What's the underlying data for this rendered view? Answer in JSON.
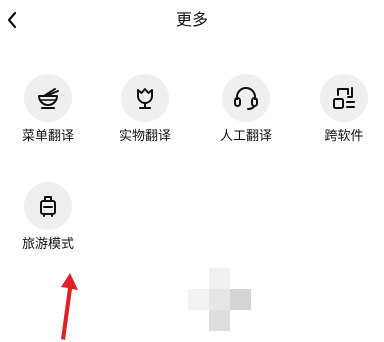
{
  "header": {
    "back_icon": "chevron-left-icon",
    "title": "更多"
  },
  "tiles": [
    {
      "label": "菜单翻译",
      "icon": "bowl-icon"
    },
    {
      "label": "实物翻译",
      "icon": "tulip-icon"
    },
    {
      "label": "人工翻译",
      "icon": "headset-icon"
    },
    {
      "label": "跨软件",
      "icon": "apps-icon"
    },
    {
      "label": "旅游模式",
      "icon": "suitcase-icon"
    }
  ],
  "colors": {
    "icon_bg": "#efefef",
    "icon_stroke": "#111111",
    "annotation_arrow": "#e01f26",
    "loader_light": "#f2f2f2",
    "loader_mid": "#e2e2e2",
    "loader_dark": "#d4d4d4"
  }
}
